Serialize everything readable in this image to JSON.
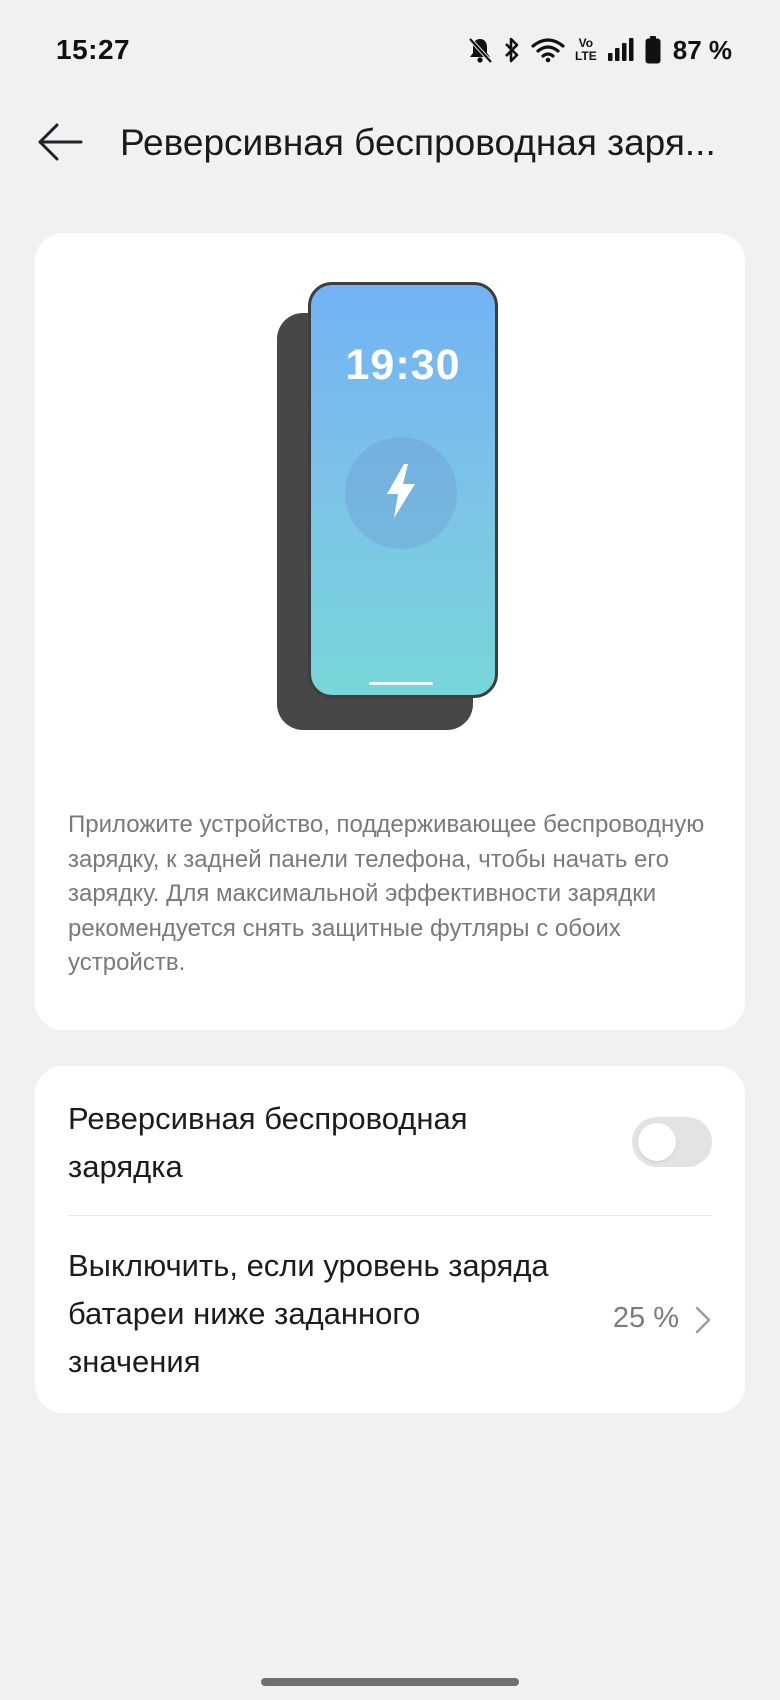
{
  "status_bar": {
    "time": "15:27",
    "icons": [
      "bell-off-icon",
      "bluetooth-icon",
      "wifi-icon",
      "volte-icon",
      "cellular-signal-icon",
      "battery-icon"
    ],
    "volte_top": "Vo",
    "volte_bottom": "LTE",
    "battery": "87 %"
  },
  "app_bar": {
    "back_icon": "arrow-left-icon",
    "title": "Реверсивная беспроводная заря..."
  },
  "illustration": {
    "phone_time": "19:30",
    "icon": "lightning-bolt-icon",
    "description": "Приложите устройство, поддерживающее беспроводную зарядку, к задней панели телефона, чтобы начать его зарядку. Для максимальной эффективности зарядки рекомендуется снять защитные футляры с обоих устройств."
  },
  "settings": {
    "reverse_charging": {
      "label": "Реверсивная беспроводная зарядка",
      "enabled": false
    },
    "threshold": {
      "label": "Выключить, если уровень заряда батареи ниже заданного значения",
      "value": "25 %",
      "icon": "chevron-right-icon"
    }
  },
  "colors": {
    "background": "#f0f1f3",
    "card": "#ffffff",
    "text_primary": "#1c1c1e",
    "text_secondary": "#7a7a7a",
    "phone_gradient_top": "#72b2f5",
    "phone_gradient_bottom": "#77d6d9",
    "toggle_off": "#e3e3e5"
  }
}
